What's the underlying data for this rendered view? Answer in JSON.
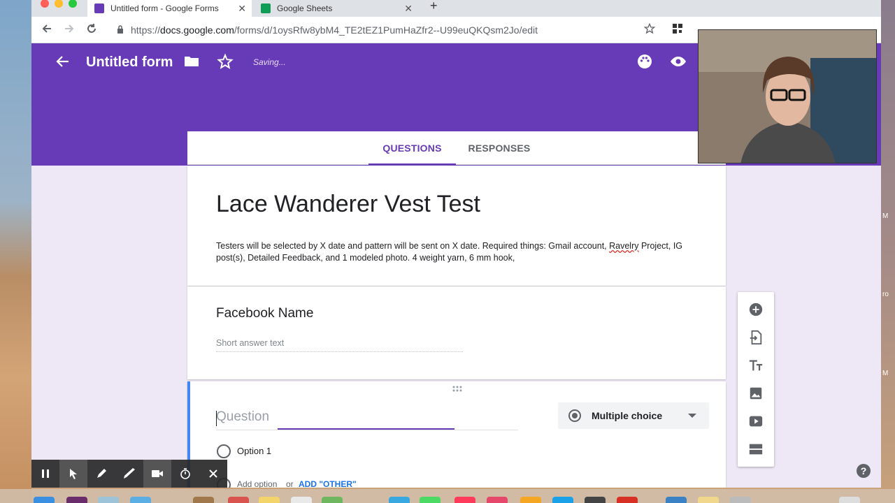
{
  "browser": {
    "tabs": [
      {
        "title": "Untitled form - Google Forms",
        "active": true,
        "icon": "google-forms-icon",
        "color": "#673ab7"
      },
      {
        "title": "Google Sheets",
        "active": false,
        "icon": "google-sheets-icon",
        "color": "#0f9d58"
      }
    ],
    "close_glyph": "✕",
    "new_tab_glyph": "+",
    "url_scheme": "https://",
    "url_host": "docs.google.com",
    "url_path": "/forms/d/1oysRfw8ybM4_TE2tEZ1PumHaZfr2--U99euQKQsm2Jo/edit"
  },
  "header": {
    "title": "Untitled form",
    "status": "Saving...",
    "color": "#673ab7"
  },
  "form_tabs": {
    "questions": "QUESTIONS",
    "responses": "RESPONSES"
  },
  "form": {
    "title": "Lace Wanderer Vest Test",
    "description_before": "Testers will be selected by X date and pattern will be sent on X date. Required things: Gmail account, ",
    "description_misspelled": "Ravelry",
    "description_after": " Project, IG post(s), Detailed Feedback, and 1 modeled photo. 4 weight yarn, 6 mm hook,",
    "items": [
      {
        "title": "Facebook Name",
        "placeholder": "Short answer text"
      }
    ],
    "editing": {
      "question_placeholder": "Question",
      "type": "Multiple choice",
      "option_1": "Option 1",
      "add_option": "Add option",
      "or": "or",
      "add_other": "ADD \"OTHER\""
    }
  },
  "side_toolbar": [
    "add-question-icon",
    "import-questions-icon",
    "add-title-icon",
    "add-image-icon",
    "add-video-icon",
    "add-section-icon"
  ],
  "help": "?",
  "desktop_labels": [
    "M",
    "ro",
    "M"
  ]
}
